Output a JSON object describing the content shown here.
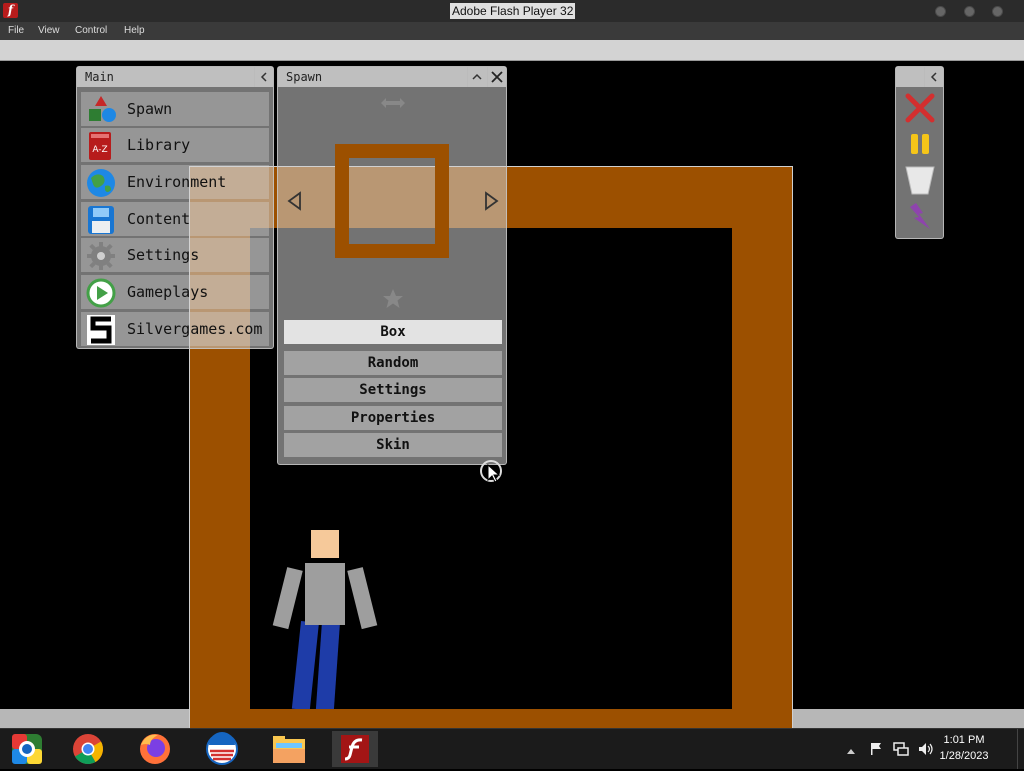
{
  "window": {
    "title": "Adobe Flash Player 32",
    "app_icon": "flash-icon",
    "app_icon_glyph": "f"
  },
  "menubar": {
    "items": [
      "File",
      "View",
      "Control",
      "Help"
    ]
  },
  "main_panel": {
    "title": "Main",
    "collapse_icon": "chevron-left-icon",
    "items": [
      {
        "label": "Spawn",
        "icon": "shapes-icon"
      },
      {
        "label": "Library",
        "icon": "book-icon",
        "icon_text": "A-Z"
      },
      {
        "label": "Environment",
        "icon": "globe-icon"
      },
      {
        "label": "Content",
        "icon": "floppy-disk-icon"
      },
      {
        "label": "Settings",
        "icon": "gear-icon"
      },
      {
        "label": "Gameplays",
        "icon": "play-icon"
      },
      {
        "label": "Silvergames.com",
        "icon": "silvergames-logo-icon"
      }
    ]
  },
  "spawn_panel": {
    "title": "Spawn",
    "collapse_icon": "chevron-up-icon",
    "close_icon": "close-icon",
    "resize_icon": "horizontal-arrows-icon",
    "prev_icon": "triangle-left-icon",
    "next_icon": "triangle-right-icon",
    "favorite_icon": "star-icon",
    "preview_color": "#9c5000",
    "buttons": [
      {
        "label": "Box",
        "selected": true
      },
      {
        "label": "Random",
        "selected": false
      },
      {
        "label": "Settings",
        "selected": false
      },
      {
        "label": "Properties",
        "selected": false
      },
      {
        "label": "Skin",
        "selected": false
      }
    ]
  },
  "tool_panel": {
    "collapse_icon": "chevron-left-icon",
    "tools": [
      {
        "icon": "red-x-icon",
        "color": "#d32f2f"
      },
      {
        "icon": "pause-icon",
        "color": "#f5c518"
      },
      {
        "icon": "funnel-icon",
        "color": "#e8e8e8"
      },
      {
        "icon": "lightning-icon",
        "color": "#8e44ad"
      }
    ]
  },
  "scene": {
    "wall_color": "#9c5000",
    "skin_color": "#f6c99a",
    "shirt_color": "#9e9e9e",
    "pants_color": "#1e3ca8"
  },
  "taskbar": {
    "apps": [
      {
        "icon": "windows-media-center-icon"
      },
      {
        "icon": "chrome-icon"
      },
      {
        "icon": "firefox-icon"
      },
      {
        "icon": "obama-logo-icon"
      },
      {
        "icon": "file-explorer-icon"
      },
      {
        "icon": "flash-player-icon",
        "active": true
      }
    ],
    "tray_icons": [
      "show-hidden-icons-icon",
      "flag-icon",
      "network-icon",
      "volume-icon"
    ],
    "time": "1:01 PM",
    "date": "1/28/2023"
  }
}
